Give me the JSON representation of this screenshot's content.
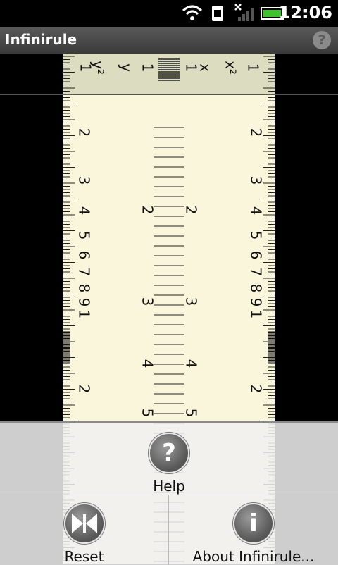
{
  "status_bar": {
    "time": "12:06"
  },
  "app": {
    "title": "Infinirule",
    "help_icon": "?"
  },
  "slide_rule": {
    "top_scale_labels": [
      "1",
      "y²",
      "y",
      "1",
      "1",
      "x",
      "x²",
      "1"
    ],
    "left_scale_numbers": [
      "2",
      "3",
      "4",
      "5",
      "6",
      "7",
      "8",
      "9",
      "1",
      "2"
    ],
    "right_scale_numbers": [
      "2",
      "3",
      "4",
      "5",
      "6",
      "7",
      "8",
      "9",
      "1",
      "2"
    ],
    "center_scale_numbers": [
      "2",
      "2",
      "3",
      "3",
      "4",
      "4",
      "5",
      "5"
    ]
  },
  "menu": {
    "items": [
      {
        "label": "Help",
        "icon": "help-icon",
        "glyph": "?"
      },
      {
        "label": "Reset",
        "icon": "reset-icon"
      },
      {
        "label": "About Infinirule...",
        "icon": "info-icon",
        "glyph": "i"
      }
    ]
  }
}
